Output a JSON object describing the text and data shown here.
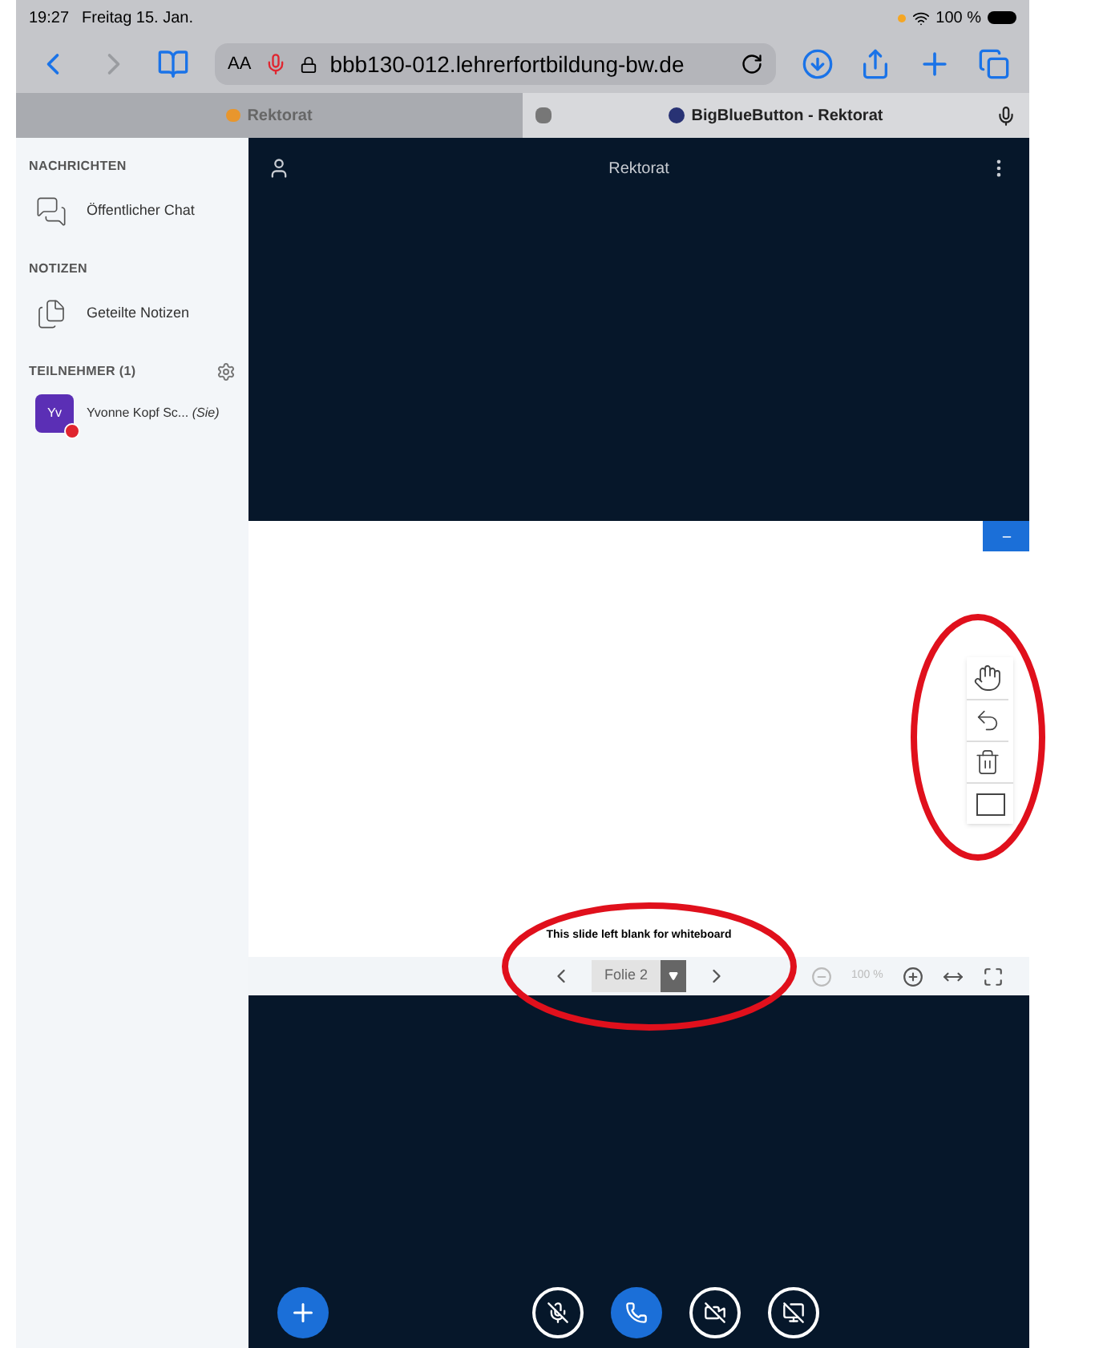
{
  "status_bar": {
    "time": "19:27",
    "date": "Freitag 15. Jan.",
    "battery": "100 %"
  },
  "address_bar": {
    "text_size": "AA",
    "url": "bbb130-012.lehrerfortbildung-bw.de"
  },
  "tabs": [
    {
      "label": "Rektorat",
      "selected": false
    },
    {
      "label": "BigBlueButton - Rektorat",
      "selected": true
    }
  ],
  "sidebar": {
    "sections": [
      {
        "heading": "NACHRICHTEN",
        "items": [
          {
            "kind": "chat",
            "label": "Öffentlicher Chat"
          }
        ]
      },
      {
        "heading": "NOTIZEN",
        "items": [
          {
            "kind": "notes",
            "label": "Geteilte Notizen"
          }
        ]
      },
      {
        "heading": "TEILNEHMER (1)",
        "items": [
          {
            "kind": "user",
            "initials": "Yv",
            "label": "Yvonne Kopf Sc...",
            "suffix": "(Sie)"
          }
        ]
      }
    ]
  },
  "meeting": {
    "title": "Rektorat"
  },
  "whiteboard": {
    "slide_text": "This slide left blank for whiteboard",
    "slide": "Folie 2",
    "zoom": "100 %"
  }
}
